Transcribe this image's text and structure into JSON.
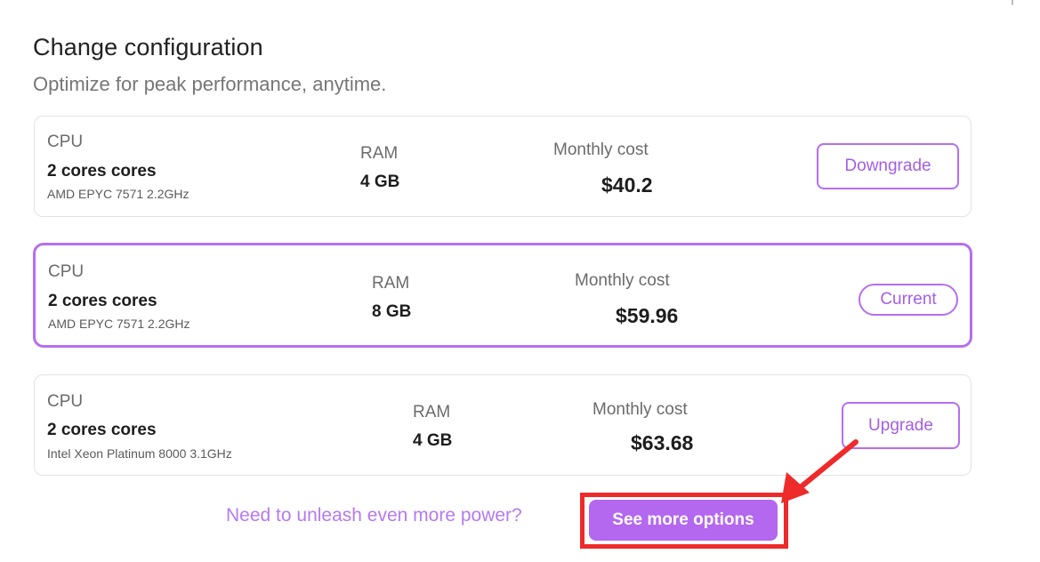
{
  "header": {
    "title": "Change configuration",
    "subtitle": "Optimize for peak performance, anytime."
  },
  "configs": [
    {
      "cpu_label": "CPU",
      "cpu_cores": "2 cores cores",
      "cpu_model": "AMD EPYC 7571 2.2GHz",
      "ram_label": "RAM",
      "ram_value": "4 GB",
      "cost_label": "Monthly cost",
      "cost_value": "$40.2",
      "action_label": "Downgrade",
      "state": "downgrade"
    },
    {
      "cpu_label": "CPU",
      "cpu_cores": "2 cores cores",
      "cpu_model": "AMD EPYC 7571 2.2GHz",
      "ram_label": "RAM",
      "ram_value": "8 GB",
      "cost_label": "Monthly cost",
      "cost_value": "$59.96",
      "action_label": "Current",
      "state": "current"
    },
    {
      "cpu_label": "CPU",
      "cpu_cores": "2 cores cores",
      "cpu_model": "Intel Xeon Platinum 8000 3.1GHz",
      "ram_label": "RAM",
      "ram_value": "4 GB",
      "cost_label": "Monthly cost",
      "cost_value": "$63.68",
      "action_label": "Upgrade",
      "state": "upgrade"
    }
  ],
  "footer": {
    "promo_text": "Need to unleash even more power?",
    "more_button_label": "See more options"
  },
  "colors": {
    "accent": "#b56ef0",
    "annotation": "#ef2a2a"
  }
}
